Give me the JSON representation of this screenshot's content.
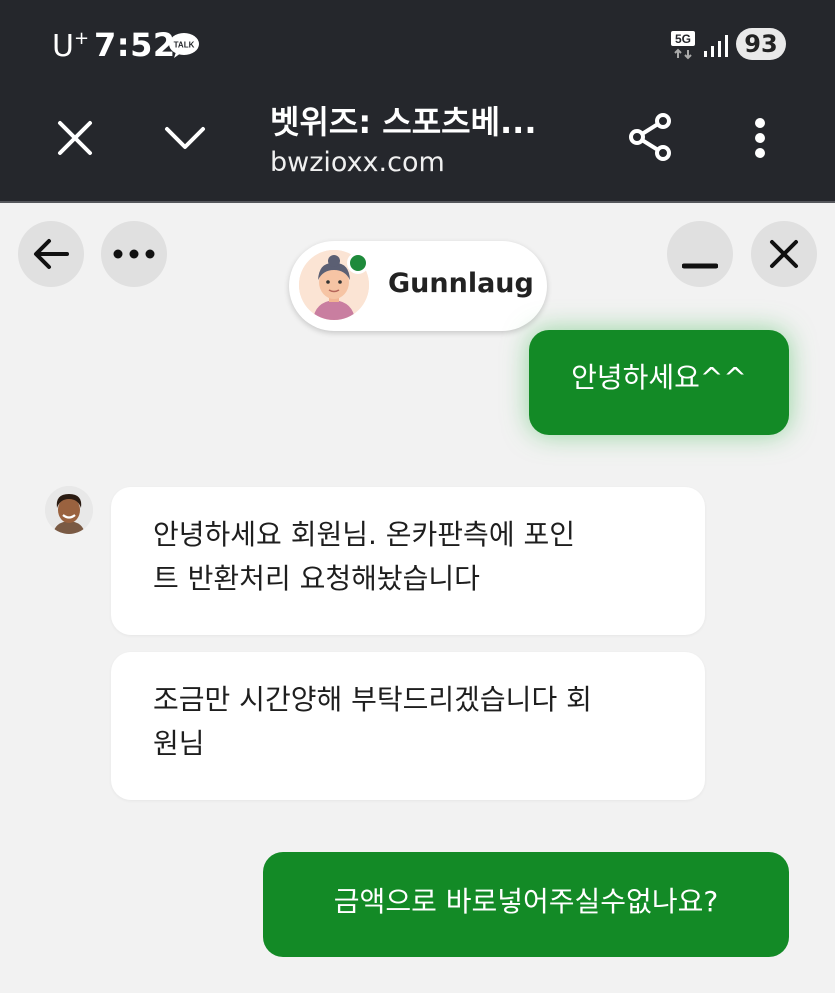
{
  "status_bar": {
    "carrier": "U",
    "carrier_sup": "+",
    "time": "7:52",
    "talk_badge": "TALK",
    "network": "5G",
    "battery": "93"
  },
  "browser": {
    "title": "벳위즈: 스포츠베...",
    "url": "bwzioxx.com"
  },
  "chat": {
    "agent_name": "Gunnlaug",
    "messages": [
      {
        "from": "user",
        "text": "안녕하세요^^"
      },
      {
        "from": "agent",
        "text": "안녕하세요 회원님. 온카판측에 포인트 반환처리 요청해놨습니다",
        "lines": [
          "안녕하세요 회원님. 온카판측에 포인",
          "트 반환처리 요청해놨습니다"
        ]
      },
      {
        "from": "agent",
        "text": "조금만 시간양해 부탁드리겠습니다 회원님",
        "lines": [
          "조금만 시간양해 부탁드리겠습니다 회",
          "원님"
        ]
      },
      {
        "from": "user",
        "text": "금액으로 바로넣어주실수없나요?"
      }
    ]
  },
  "colors": {
    "top_bar": "#25272c",
    "user_bubble": "#138a26",
    "online_status": "#1e8a3b",
    "chat_background": "#f2f2f2"
  },
  "icons": [
    "talk-icon",
    "5g-icon",
    "signal-icon",
    "close-icon",
    "chevron-down-icon",
    "share-icon",
    "more-vert-icon",
    "arrow-left-icon",
    "more-horiz-icon",
    "minimize-icon",
    "close-icon",
    "agent-avatar",
    "staff-avatar"
  ]
}
